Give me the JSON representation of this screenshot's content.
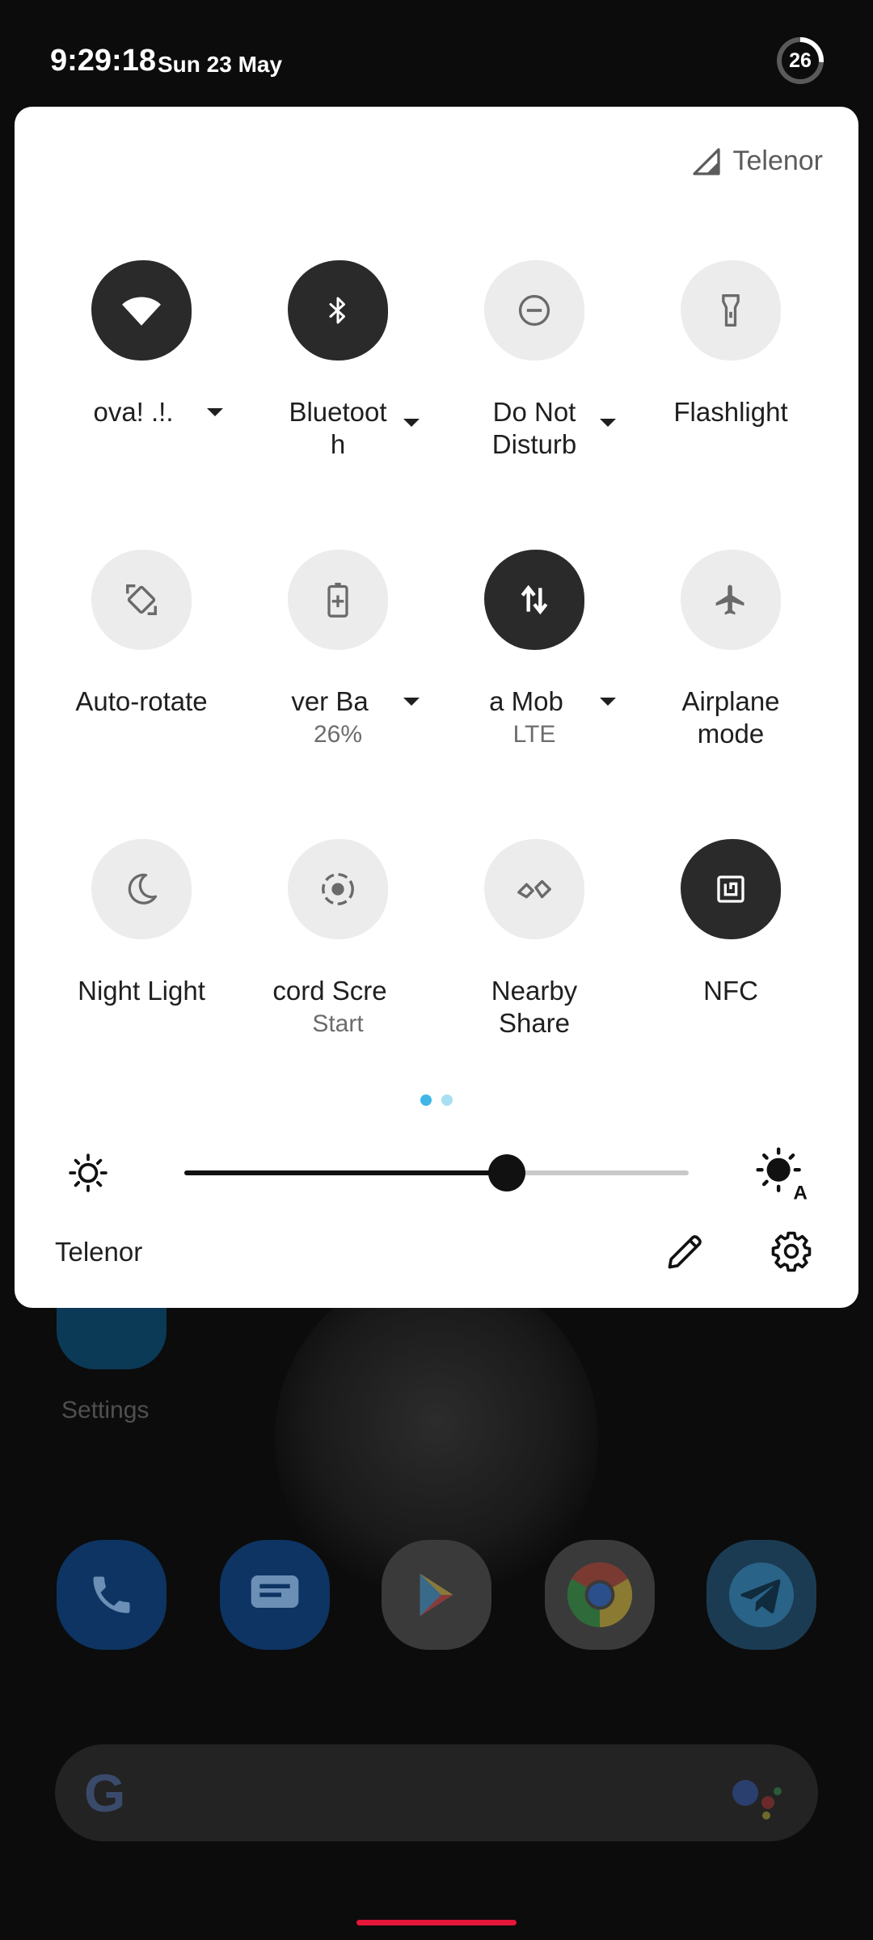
{
  "status_bar": {
    "time": "9:29:18",
    "date": "Sun 23 May",
    "battery_level": "26",
    "battery_fraction": 0.26
  },
  "quick_settings": {
    "carrier": "Telenor",
    "tiles": [
      {
        "label": "ova!   .!.",
        "sublabel": "",
        "icon": "wifi-icon",
        "active": true,
        "has_menu": true
      },
      {
        "label": "Bluetoot\nh",
        "sublabel": "",
        "icon": "bluetooth-icon",
        "active": true,
        "has_menu": true
      },
      {
        "label": "Do Not\nDisturb",
        "sublabel": "",
        "icon": "do-not-disturb-icon",
        "active": false,
        "has_menu": true
      },
      {
        "label": "Flashlight",
        "sublabel": "",
        "icon": "flashlight-icon",
        "active": false,
        "has_menu": false
      },
      {
        "label": "Auto-rotate",
        "sublabel": "",
        "icon": "auto-rotate-icon",
        "active": false,
        "has_menu": false
      },
      {
        "label": "ver    Ba",
        "sublabel": "26%",
        "icon": "battery-saver-icon",
        "active": false,
        "has_menu": true
      },
      {
        "label": "a    Mob",
        "sublabel": "LTE",
        "icon": "mobile-data-icon",
        "active": true,
        "has_menu": true
      },
      {
        "label": "Airplane\nmode",
        "sublabel": "",
        "icon": "airplane-icon",
        "active": false,
        "has_menu": false
      },
      {
        "label": "Night Light",
        "sublabel": "",
        "icon": "night-light-icon",
        "active": false,
        "has_menu": false
      },
      {
        "label": "cord     Scre",
        "sublabel": "Start",
        "icon": "screen-record-icon",
        "active": false,
        "has_menu": false
      },
      {
        "label": "Nearby\nShare",
        "sublabel": "",
        "icon": "nearby-share-icon",
        "active": false,
        "has_menu": false
      },
      {
        "label": "NFC",
        "sublabel": "",
        "icon": "nfc-icon",
        "active": true,
        "has_menu": false
      }
    ],
    "page_count": 2,
    "current_page": 1,
    "brightness_level": 0.64,
    "footer_carrier": "Telenor"
  },
  "home_screen": {
    "settings_label": "Settings",
    "dock_apps": [
      "phone-icon",
      "messages-icon",
      "play-store-icon",
      "chrome-icon",
      "telegram-icon"
    ],
    "search_logo": "G"
  },
  "colors": {
    "panel_bg": "#ffffff",
    "tile_active": "#2a2a2a",
    "tile_inactive": "#ececec",
    "page_dot_active": "#3fb6e6",
    "page_dot_inactive": "#a9dff2",
    "nav_handle": "#e4163a"
  }
}
